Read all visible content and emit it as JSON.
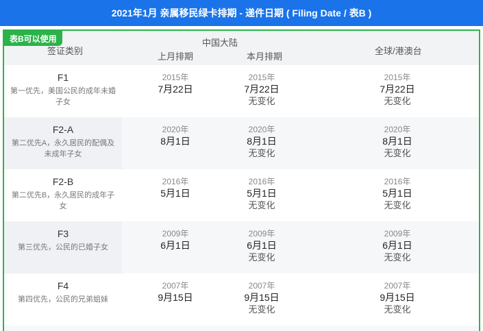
{
  "banner": {
    "title": "2021年1月 亲属移民绿卡排期 - 递件日期 ( Filing Date / 表B )"
  },
  "badge": {
    "label": "表B可以使用"
  },
  "header": {
    "category": "签证类别",
    "mainland": "中国大陆",
    "last_month": "上月排期",
    "this_month": "本月排期",
    "global": "全球/港澳台"
  },
  "rows": [
    {
      "code": "F1",
      "desc": "第一优先，美国公民的成年未婚子女",
      "last": {
        "year": "2015年",
        "date": "7月22日"
      },
      "this": {
        "year": "2015年",
        "date": "7月22日",
        "change": "无变化"
      },
      "global": {
        "year": "2015年",
        "date": "7月22日",
        "change": "无变化"
      }
    },
    {
      "code": "F2-A",
      "desc": "第二优先A，永久居民的配偶及未成年子女",
      "last": {
        "year": "2020年",
        "date": "8月1日"
      },
      "this": {
        "year": "2020年",
        "date": "8月1日",
        "change": "无变化"
      },
      "global": {
        "year": "2020年",
        "date": "8月1日",
        "change": "无变化"
      }
    },
    {
      "code": "F2-B",
      "desc": "第二优先B，永久居民的成年子女",
      "last": {
        "year": "2016年",
        "date": "5月1日"
      },
      "this": {
        "year": "2016年",
        "date": "5月1日",
        "change": "无变化"
      },
      "global": {
        "year": "2016年",
        "date": "5月1日",
        "change": "无变化"
      }
    },
    {
      "code": "F3",
      "desc": "第三优先，公民的已婚子女",
      "last": {
        "year": "2009年",
        "date": "6月1日"
      },
      "this": {
        "year": "2009年",
        "date": "6月1日",
        "change": "无变化"
      },
      "global": {
        "year": "2009年",
        "date": "6月1日",
        "change": "无变化"
      }
    },
    {
      "code": "F4",
      "desc": "第四优先，公民的兄弟姐妹",
      "last": {
        "year": "2007年",
        "date": "9月15日"
      },
      "this": {
        "year": "2007年",
        "date": "9月15日",
        "change": "无变化"
      },
      "global": {
        "year": "2007年",
        "date": "9月15日",
        "change": "无变化"
      }
    }
  ]
}
